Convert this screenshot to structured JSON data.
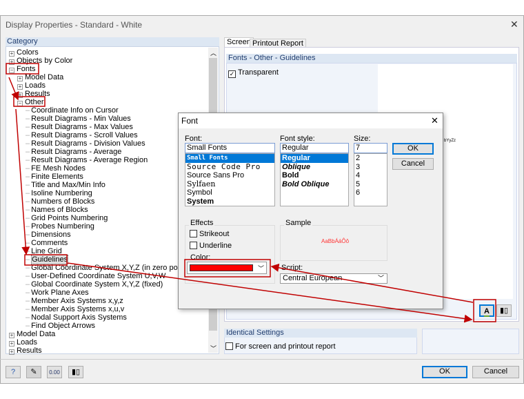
{
  "window": {
    "title": "Display Properties - Standard - White",
    "close": "✕"
  },
  "category": {
    "header": "Category",
    "top": [
      {
        "label": "Colors",
        "exp": "+"
      },
      {
        "label": "Objects by Color",
        "exp": "+"
      },
      {
        "label": "Fonts",
        "exp": "−"
      }
    ],
    "fonts_children": [
      {
        "label": "Model Data",
        "exp": "+"
      },
      {
        "label": "Loads",
        "exp": "+"
      },
      {
        "label": "Results",
        "exp": "+"
      },
      {
        "label": "Other",
        "exp": "−"
      }
    ],
    "other_children": [
      "Coordinate Info on Cursor",
      "Result Diagrams - Min Values",
      "Result Diagrams - Max Values",
      "Result Diagrams - Scroll Values",
      "Result Diagrams - Division Values",
      "Result Diagrams - Average",
      "Result Diagrams - Average Region",
      "FE Mesh Nodes",
      "Finite Elements",
      "Title and Max/Min Info",
      "Isoline Numbering",
      "Numbers of Blocks",
      "Names of Blocks",
      "Grid Points Numbering",
      "Probes Numbering",
      "Dimensions",
      "Comments",
      "Line Grid",
      "Guidelines",
      "Global Coordinate System X,Y,Z (in zero point)",
      "User-Defined Coordinate System U,V,W",
      "Global Coordinate System X,Y,Z (fixed)",
      "Work Plane Axes",
      "Member Axis Systems x,y,z",
      "Member Axis Systems x,u,v",
      "Nodal Support Axis Systems",
      "Find Object Arrows"
    ],
    "selected": "Guidelines",
    "bottom": [
      {
        "label": "Model Data",
        "exp": "+"
      },
      {
        "label": "Loads",
        "exp": "+"
      },
      {
        "label": "Results",
        "exp": "+"
      }
    ]
  },
  "tabs": [
    {
      "label": "Screen",
      "active": true
    },
    {
      "label": "Printout Report"
    }
  ],
  "panel": {
    "header": "Fonts - Other - Guidelines",
    "transparent_label": "Transparent",
    "transparent_checked": true,
    "preview_text": "bYyZz"
  },
  "identical": {
    "header": "Identical Settings",
    "checkbox_label": "For screen and printout report",
    "checked": false
  },
  "font_dialog": {
    "title": "Font",
    "font_label": "Font:",
    "font_value": "Small Fonts",
    "fonts": [
      "Small Fonts",
      "Source Code Pro",
      "Source Sans Pro",
      "Sylfaen",
      "Symbol",
      "System"
    ],
    "style_label": "Font style:",
    "style_value": "Regular",
    "styles": [
      "Regular",
      "Oblique",
      "Bold",
      "Bold Oblique"
    ],
    "size_label": "Size:",
    "size_value": "7",
    "sizes": [
      "2",
      "3",
      "4",
      "5",
      "6"
    ],
    "ok": "OK",
    "cancel": "Cancel",
    "effects_label": "Effects",
    "strikeout": "Strikeout",
    "underline": "Underline",
    "color_label": "Color:",
    "color_value": "#ff0000",
    "sample_label": "Sample",
    "sample_text": "AaBbÁáÔô",
    "script_label": "Script:",
    "script_value": "Central European"
  },
  "footer": {
    "ok": "OK",
    "cancel": "Cancel",
    "icons": [
      "help-icon",
      "edit-icon",
      "units-icon",
      "font-settings-icon"
    ]
  },
  "colors": {
    "annotation": "#c00000",
    "accent": "#0078d7"
  }
}
